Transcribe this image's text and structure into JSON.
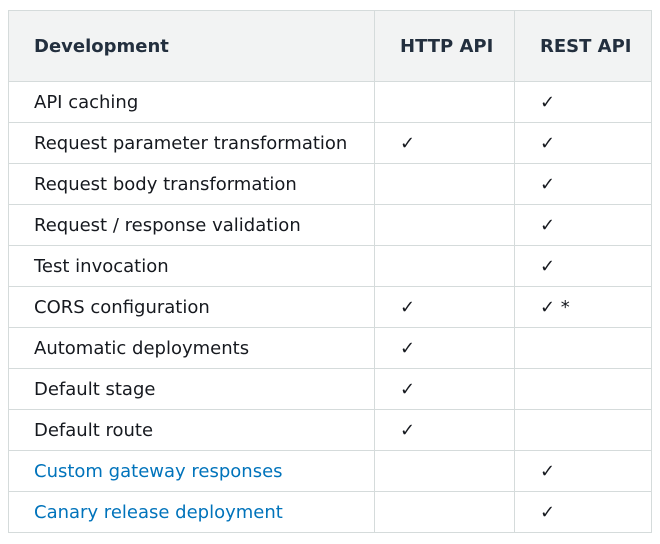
{
  "table": {
    "headers": [
      "Development",
      "HTTP API",
      "REST API"
    ],
    "rows": [
      {
        "feature": "API caching",
        "link": false,
        "http": "",
        "rest": "✓"
      },
      {
        "feature": "Request parameter transformation",
        "link": false,
        "http": "✓",
        "rest": "✓"
      },
      {
        "feature": "Request body transformation",
        "link": false,
        "http": "",
        "rest": "✓"
      },
      {
        "feature": "Request / response validation",
        "link": false,
        "http": "",
        "rest": "✓"
      },
      {
        "feature": "Test invocation",
        "link": false,
        "http": "",
        "rest": "✓"
      },
      {
        "feature": "CORS configuration",
        "link": false,
        "http": "✓",
        "rest": "✓ *"
      },
      {
        "feature": "Automatic deployments",
        "link": false,
        "http": "✓",
        "rest": ""
      },
      {
        "feature": "Default stage",
        "link": false,
        "http": "✓",
        "rest": ""
      },
      {
        "feature": "Default route",
        "link": false,
        "http": "✓",
        "rest": ""
      },
      {
        "feature": "Custom gateway responses",
        "link": true,
        "http": "",
        "rest": "✓"
      },
      {
        "feature": "Canary release deployment",
        "link": true,
        "http": "",
        "rest": "✓"
      }
    ]
  },
  "colors": {
    "link": "#0073bb",
    "header_bg": "#f2f3f3",
    "border": "#d5dbdb"
  }
}
